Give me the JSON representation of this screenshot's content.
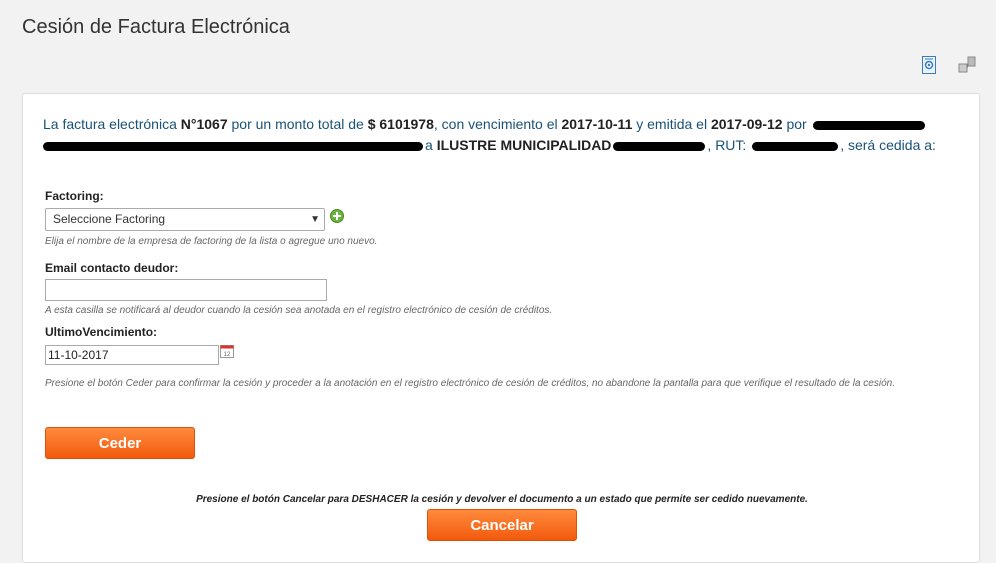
{
  "page": {
    "title": "Cesión de Factura Electrónica"
  },
  "toolbar": {
    "icon1": "document-settings-icon",
    "icon2": "network-icon"
  },
  "intro": {
    "part1": "La factura electrónica ",
    "number": "N°1067",
    "part2": " por un monto total de ",
    "amount": "$ 6101978",
    "part3": ", con vencimiento el ",
    "due_date": "2017-10-11",
    "part4": " y emitida el ",
    "issue_date": "2017-09-12",
    "part5": " por ",
    "part6": "a ",
    "receiver": "ILUSTRE MUNICIPALIDAD",
    "part7": ", RUT: ",
    "part8": ", será cedida a:"
  },
  "form": {
    "factoring_label": "Factoring:",
    "factoring_selected": "Seleccione Factoring",
    "factoring_help": "Elija el nombre de la empresa de factoring de la lista o agregue uno nuevo.",
    "email_label": "Email contacto deudor:",
    "email_value": "",
    "email_help": "A esta casilla se notificará al deudor cuando la cesión sea anotada en el registro electrónico de cesión de créditos.",
    "due_label": "UltimoVencimiento:",
    "due_value": "11-10-2017",
    "ceder_help": "Presione el botón Ceder para confirmar la cesión y proceder a la anotación en el registro electrónico de cesión de créditos, no abandone la pantalla para que verifique el resultado de la cesión."
  },
  "actions": {
    "ceder_label": "Ceder",
    "cancel_note": "Presione el botón Cancelar para DESHACER la cesión y devolver el documento a un estado que permite ser cedido nuevamente.",
    "cancel_label": "Cancelar"
  },
  "colors": {
    "accent": "#f25a0c",
    "text_blue": "#1a5276"
  }
}
